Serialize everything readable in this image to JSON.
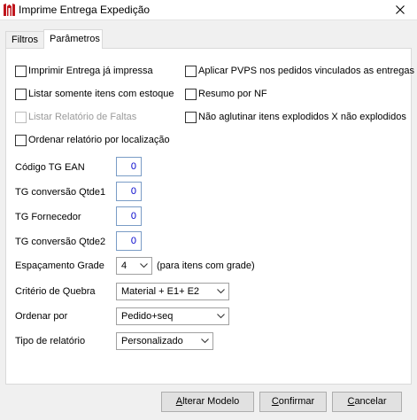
{
  "window": {
    "title": "Imprime Entrega Expedição",
    "close_glyph": "✕",
    "app_icon": "app-logo-icon"
  },
  "tabs": [
    {
      "label": "Filtros",
      "active": false
    },
    {
      "label": "Parâmetros",
      "active": true
    }
  ],
  "checkboxes_left": [
    {
      "label": "Imprimir Entrega já impressa",
      "checked": false,
      "enabled": true
    },
    {
      "label": "Listar somente itens com estoque",
      "checked": false,
      "enabled": true
    },
    {
      "label": "Listar Relatório de Faltas",
      "checked": false,
      "enabled": false
    },
    {
      "label": "Ordenar relatório por localização",
      "checked": false,
      "enabled": true
    }
  ],
  "checkboxes_right": [
    {
      "label": "Aplicar PVPS nos pedidos vinculados as entregas",
      "checked": false,
      "enabled": true
    },
    {
      "label": "Resumo por NF",
      "checked": false,
      "enabled": true
    },
    {
      "label": "Não aglutinar itens explodidos X não explodidos",
      "checked": false,
      "enabled": true
    }
  ],
  "numeric_fields": [
    {
      "label": "Código TG EAN",
      "value": "0"
    },
    {
      "label": "TG conversão Qtde1",
      "value": "0"
    },
    {
      "label": "TG Fornecedor",
      "value": "0"
    },
    {
      "label": "TG conversão Qtde2",
      "value": "0"
    }
  ],
  "espacamento": {
    "label": "Espaçamento Grade",
    "value": "4",
    "suffix": "(para itens com grade)"
  },
  "criterio": {
    "label": "Critério de Quebra",
    "value": "Material + E1+ E2"
  },
  "ordenar": {
    "label": "Ordenar por",
    "value": "Pedido+seq"
  },
  "tipo": {
    "label": "Tipo de relatório",
    "value": "Personalizado"
  },
  "buttons": {
    "alterar": {
      "first": "A",
      "rest": "lterar Modelo"
    },
    "confirmar": {
      "first": "C",
      "rest": "onfirmar"
    },
    "cancelar": {
      "first": "C",
      "rest": "ancelar"
    }
  },
  "colors": {
    "number_value": "#0000cc",
    "app_icon_red": "#c0161d",
    "field_border": "#7a9cc6"
  }
}
